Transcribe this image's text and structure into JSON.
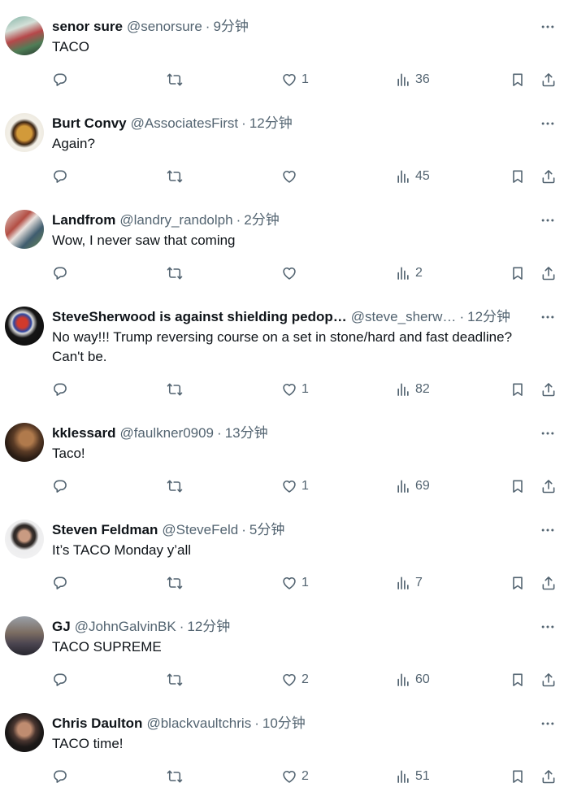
{
  "theme": {
    "text_primary": "#0f1419",
    "text_secondary": "#536471",
    "background": "#ffffff"
  },
  "icons": {
    "more": "more-icon",
    "reply": "reply-icon",
    "retweet": "retweet-icon",
    "like": "heart-icon",
    "views": "views-icon",
    "bookmark": "bookmark-icon",
    "share": "share-icon"
  },
  "meta": {
    "separator": "·"
  },
  "replies": [
    {
      "name": "senor sure",
      "handle": "@senorsure",
      "time": "9分钟",
      "text": "TACO",
      "likes": "1",
      "views": "36"
    },
    {
      "name": "Burt Convy",
      "handle": "@AssociatesFirst",
      "time": "12分钟",
      "text": "Again?",
      "likes": "",
      "views": "45"
    },
    {
      "name": "Landfrom",
      "handle": "@landry_randolph",
      "time": "2分钟",
      "text": "Wow, I never saw that coming",
      "likes": "",
      "views": "2"
    },
    {
      "name": "SteveSherwood is against shielding pedop…",
      "handle": "@steve_sherw…",
      "time": "12分钟",
      "text": "No way!!! Trump reversing course on a set in stone/hard and fast deadline? Can't be.",
      "likes": "1",
      "views": "82"
    },
    {
      "name": "kklessard",
      "handle": "@faulkner0909",
      "time": "13分钟",
      "text": "Taco!",
      "likes": "1",
      "views": "69"
    },
    {
      "name": "Steven Feldman",
      "handle": "@SteveFeld",
      "time": "5分钟",
      "text": "It’s TACO Monday y’all",
      "likes": "1",
      "views": "7"
    },
    {
      "name": "GJ",
      "handle": "@JohnGalvinBK",
      "time": "12分钟",
      "text": "TACO SUPREME",
      "likes": "2",
      "views": "60"
    },
    {
      "name": "Chris Daulton",
      "handle": "@blackvaultchris",
      "time": "10分钟",
      "text": "TACO time!",
      "likes": "2",
      "views": "51"
    }
  ]
}
